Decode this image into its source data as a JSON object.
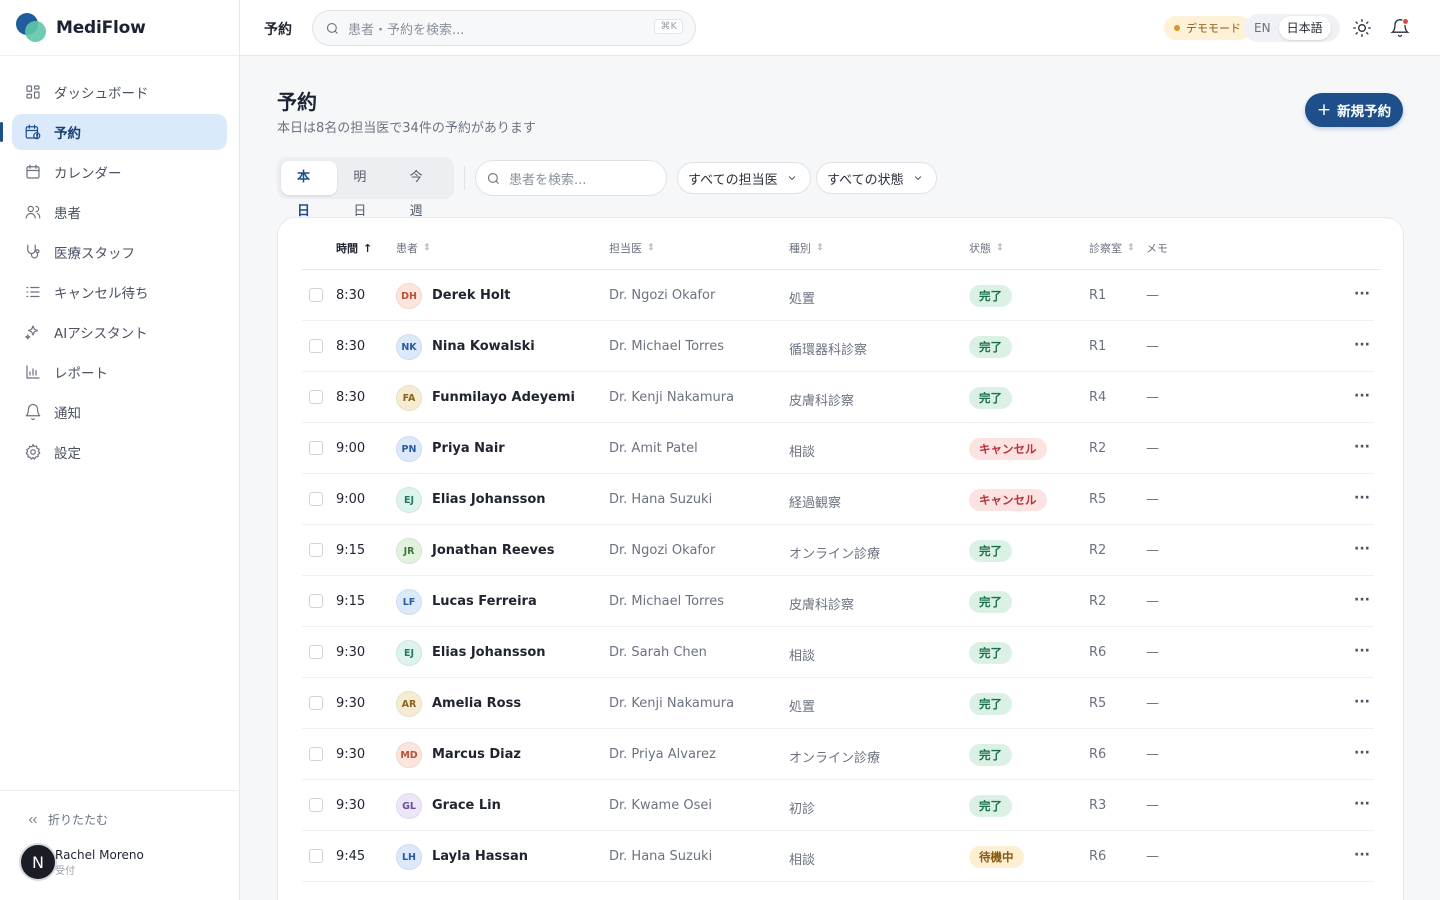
{
  "app": {
    "name": "MediFlow"
  },
  "sidebar": {
    "items": [
      {
        "label": "ダッシュボード",
        "icon": "dashboard-icon"
      },
      {
        "label": "予約",
        "icon": "calendar-clock-icon",
        "active": true
      },
      {
        "label": "カレンダー",
        "icon": "calendar-icon"
      },
      {
        "label": "患者",
        "icon": "users-icon"
      },
      {
        "label": "医療スタッフ",
        "icon": "stethoscope-icon"
      },
      {
        "label": "キャンセル待ち",
        "icon": "list-icon"
      },
      {
        "label": "AIアシスタント",
        "icon": "sparkles-icon"
      },
      {
        "label": "レポート",
        "icon": "bar-chart-icon"
      },
      {
        "label": "通知",
        "icon": "bell-icon"
      },
      {
        "label": "設定",
        "icon": "gear-icon"
      }
    ],
    "collapse_label": "折りたたむ",
    "user": {
      "initial": "N",
      "name": "Rachel Moreno",
      "role": "受付"
    }
  },
  "topbar": {
    "title": "予約",
    "search_placeholder": "患者・予約を検索...",
    "shortcut": "⌘K",
    "demo_label": "デモモード",
    "lang": {
      "en": "EN",
      "ja": "日本語",
      "selected": "ja"
    }
  },
  "page": {
    "title": "予約",
    "subtitle": "本日は8名の担当医で34件の予約があります",
    "new_button": "新規予約",
    "tabs": [
      "本日",
      "明日",
      "今週"
    ],
    "active_tab": 0,
    "patient_search_placeholder": "患者を検索...",
    "doctor_filter": "すべての担当医",
    "status_filter": "すべての状態"
  },
  "table": {
    "columns": {
      "time": "時間",
      "patient": "患者",
      "doctor": "担当医",
      "type": "種別",
      "status": "状態",
      "room": "診察室",
      "memo": "メモ"
    },
    "rows": [
      {
        "time": "8:30",
        "initials": "DH",
        "patient": "Derek Holt",
        "doctor": "Dr. Ngozi Okafor",
        "type": "処置",
        "status": "完了",
        "room": "R1",
        "memo": "—"
      },
      {
        "time": "8:30",
        "initials": "NK",
        "patient": "Nina Kowalski",
        "doctor": "Dr. Michael Torres",
        "type": "循環器科診察",
        "status": "完了",
        "room": "R1",
        "memo": "—"
      },
      {
        "time": "8:30",
        "initials": "FA",
        "patient": "Funmilayo Adeyemi",
        "doctor": "Dr. Kenji Nakamura",
        "type": "皮膚科診察",
        "status": "完了",
        "room": "R4",
        "memo": "—"
      },
      {
        "time": "9:00",
        "initials": "PN",
        "patient": "Priya Nair",
        "doctor": "Dr. Amit Patel",
        "type": "相談",
        "status": "キャンセル",
        "room": "R2",
        "memo": "—"
      },
      {
        "time": "9:00",
        "initials": "EJ",
        "patient": "Elias Johansson",
        "doctor": "Dr. Hana Suzuki",
        "type": "経過観察",
        "status": "キャンセル",
        "room": "R5",
        "memo": "—"
      },
      {
        "time": "9:15",
        "initials": "JR",
        "patient": "Jonathan Reeves",
        "doctor": "Dr. Ngozi Okafor",
        "type": "オンライン診療",
        "status": "完了",
        "room": "R2",
        "memo": "—"
      },
      {
        "time": "9:15",
        "initials": "LF",
        "patient": "Lucas Ferreira",
        "doctor": "Dr. Michael Torres",
        "type": "皮膚科診察",
        "status": "完了",
        "room": "R2",
        "memo": "—"
      },
      {
        "time": "9:30",
        "initials": "EJ",
        "patient": "Elias Johansson",
        "doctor": "Dr. Sarah Chen",
        "type": "相談",
        "status": "完了",
        "room": "R6",
        "memo": "—"
      },
      {
        "time": "9:30",
        "initials": "AR",
        "patient": "Amelia Ross",
        "doctor": "Dr. Kenji Nakamura",
        "type": "処置",
        "status": "完了",
        "room": "R5",
        "memo": "—"
      },
      {
        "time": "9:30",
        "initials": "MD",
        "patient": "Marcus Diaz",
        "doctor": "Dr. Priya Alvarez",
        "type": "オンライン診療",
        "status": "完了",
        "room": "R6",
        "memo": "—"
      },
      {
        "time": "9:30",
        "initials": "GL",
        "patient": "Grace Lin",
        "doctor": "Dr. Kwame Osei",
        "type": "初診",
        "status": "完了",
        "room": "R3",
        "memo": "—"
      },
      {
        "time": "9:45",
        "initials": "LH",
        "patient": "Layla Hassan",
        "doctor": "Dr. Hana Suzuki",
        "type": "相談",
        "status": "待機中",
        "room": "R6",
        "memo": "—"
      }
    ]
  },
  "colors": {
    "accent": "#1f4f8a",
    "status": {
      "完了": {
        "bg": "#dcf1e6",
        "fg": "#18704a"
      },
      "キャンセル": {
        "bg": "#fde2e2",
        "fg": "#b3343a"
      },
      "待機中": {
        "bg": "#fcefd2",
        "fg": "#8a5a12"
      }
    },
    "avatars": {
      "DH": [
        "#fde4dc",
        "#b4533a"
      ],
      "NK": [
        "#dbe9fb",
        "#2a5aa0"
      ],
      "FA": [
        "#f6ecd3",
        "#8a6420"
      ],
      "PN": [
        "#dbe9fb",
        "#2a5aa0"
      ],
      "EJ": [
        "#dcf3ee",
        "#267a66"
      ],
      "JR": [
        "#e2f2df",
        "#3f7a36"
      ],
      "LF": [
        "#dbe9fb",
        "#2a5aa0"
      ],
      "AR": [
        "#f6ecd3",
        "#8a6420"
      ],
      "MD": [
        "#fde4dc",
        "#b4533a"
      ],
      "GL": [
        "#ece6f7",
        "#6a4a9c"
      ],
      "LH": [
        "#dbe9fb",
        "#2a5aa0"
      ]
    }
  }
}
